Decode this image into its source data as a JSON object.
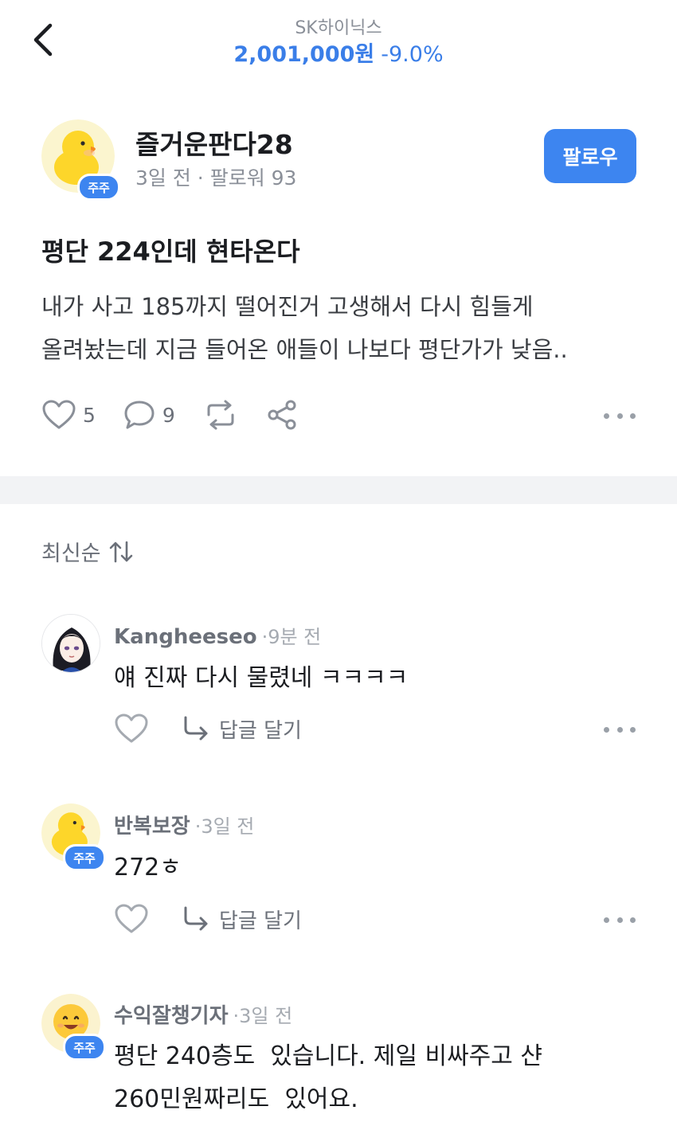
{
  "header": {
    "stock_name": "SK하이닉스",
    "price": "2,001,000원",
    "change": "-9.0%"
  },
  "post": {
    "author": "즐거운판다28",
    "badge": "주주",
    "meta": "3일 전 · 팔로워 93",
    "follow_label": "팔로우",
    "title": "평단 224인데 현타온다",
    "body_lines": [
      "내가 사고 185까지 떨어진거 고생해서 다시 힘들게",
      "올려놨는데 지금 들어온 애들이 나보다 평단가가 낮음.."
    ],
    "likes": "5",
    "comments": "9"
  },
  "sort": {
    "label": "최신순"
  },
  "comments": [
    {
      "user": "Kangheeseo",
      "time": "·9분 전",
      "lines": [
        "얘 진짜 다시 물렸네 ㅋㅋㅋㅋ"
      ],
      "reply_label": "답글 달기"
    },
    {
      "user": "반복보장",
      "time": "·3일 전",
      "badge": "주주",
      "lines": [
        "272ㅎ"
      ],
      "reply_label": "답글 달기"
    },
    {
      "user": "수익잘챙기자",
      "time": "·3일 전",
      "badge": "주주",
      "lines": [
        "평단 240층도  있습니다. 제일 비싸주고 샨",
        "260민원짜리도  있어요."
      ]
    }
  ],
  "colors": {
    "accent": "#3d85f0",
    "price": "#3a7ee8",
    "divider": "#f2f3f5"
  },
  "icons": [
    "back-icon",
    "duck-avatar",
    "heart-icon",
    "comment-icon",
    "repost-icon",
    "share-icon",
    "more-icon",
    "sort-icon",
    "reply-arrow-icon"
  ]
}
